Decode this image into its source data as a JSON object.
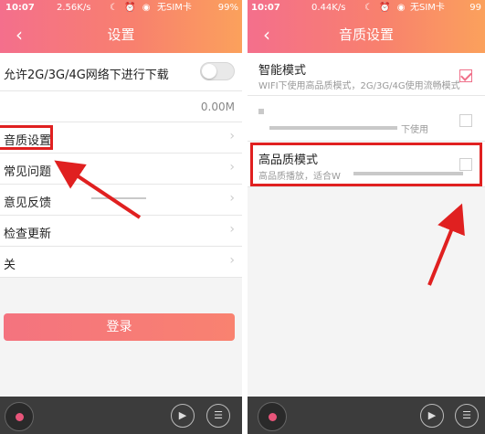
{
  "status": {
    "left": {
      "time": "10:07",
      "speed": "2.56K/s",
      "carrier": "无SIM卡",
      "battery": "99%"
    },
    "right": {
      "time": "10:07",
      "speed": "0.44K/s",
      "carrier": "无SIM卡",
      "battery": "99"
    },
    "icons": "☾ ⏰ ◉"
  },
  "left_screen": {
    "title": "设置",
    "back_icon": "‹",
    "network_toggle_label": "允许2G/3G/4G网络下进行下载",
    "network_toggle_on": false,
    "cache_value": "0.00M",
    "menu": [
      {
        "label": "音质设置"
      },
      {
        "label": "常见问题"
      },
      {
        "label": "意见反馈"
      },
      {
        "label": "检查更新"
      },
      {
        "label": "关"
      }
    ],
    "chevron": "›",
    "login_label": "登录"
  },
  "right_screen": {
    "title": "音质设置",
    "back_icon": "‹",
    "options": [
      {
        "title": "智能模式",
        "desc": "WIFI下使用高品质模式，2G/3G/4G使用流畅模式",
        "checked": true
      },
      {
        "title": "",
        "desc": "下使用",
        "checked": false
      },
      {
        "title": "高品质模式",
        "desc": "高品质播放，适合W",
        "checked": false
      }
    ]
  },
  "player": {
    "play_icon": "▶",
    "list_icon": "☰"
  },
  "colors": {
    "accent_start": "#f46f8c",
    "accent_end": "#fba15c",
    "highlight": "#e02020",
    "player_bg": "#3c3c3c"
  }
}
